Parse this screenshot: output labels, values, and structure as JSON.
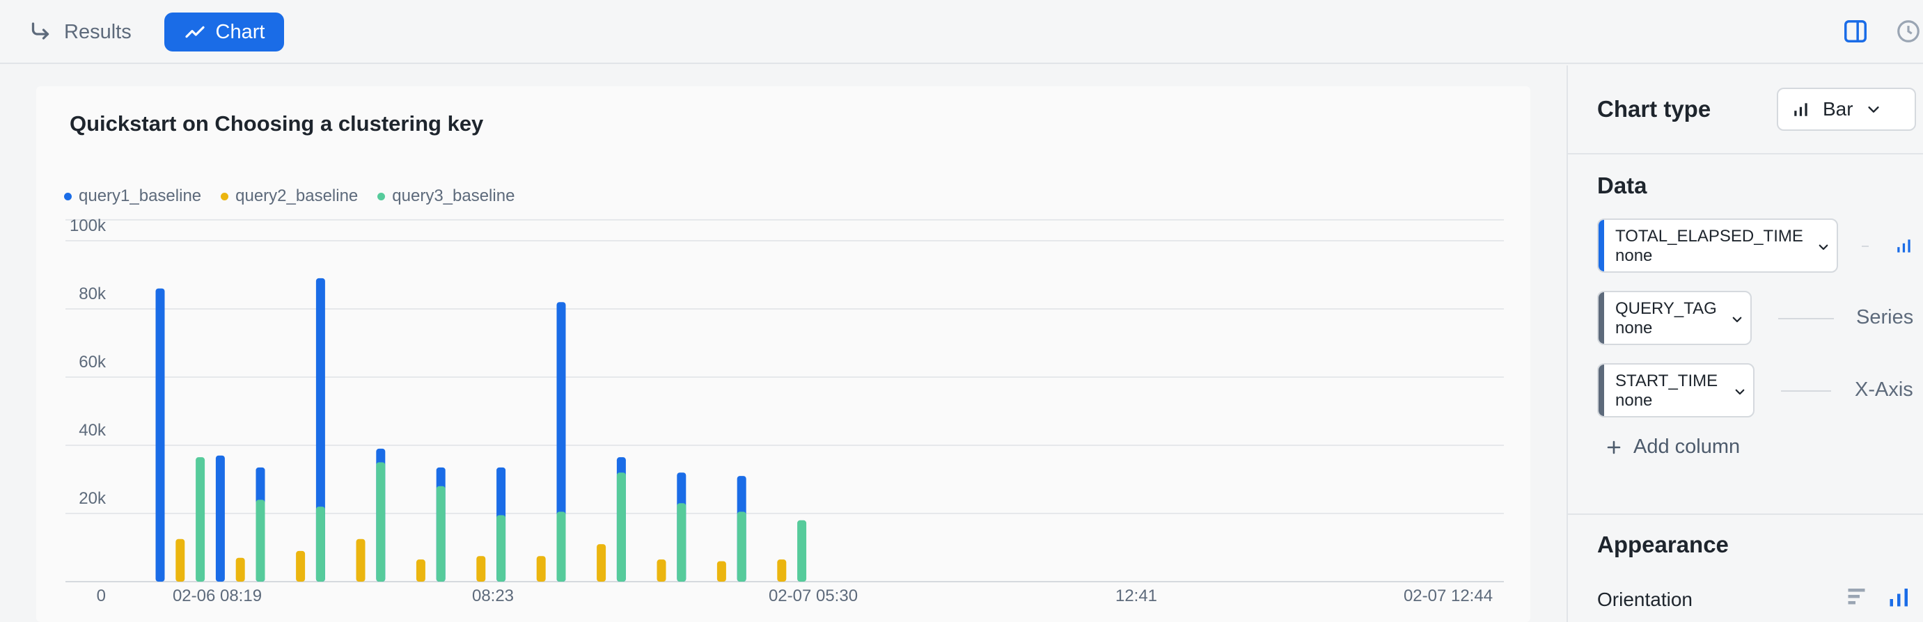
{
  "tabs": {
    "results_label": "Results",
    "chart_label": "Chart"
  },
  "chart_data": {
    "type": "bar",
    "title": "Quickstart on Choosing a clustering key",
    "series": [
      {
        "name": "query1_baseline",
        "color": "#1a6ce7",
        "values": [
          86000,
          0,
          0,
          37000,
          0,
          33500,
          0,
          0,
          89000,
          0,
          0,
          39000,
          0,
          0,
          33500,
          0,
          0,
          33500,
          0,
          0,
          82000,
          0,
          0,
          36500,
          0,
          0,
          32000,
          0,
          0,
          31000,
          0,
          0
        ]
      },
      {
        "name": "query2_baseline",
        "color": "#ebb50f",
        "values": [
          0,
          12500,
          0,
          0,
          7000,
          0,
          0,
          9000,
          0,
          0,
          12500,
          0,
          0,
          6500,
          0,
          0,
          7500,
          0,
          0,
          7500,
          0,
          0,
          11000,
          0,
          0,
          6500,
          0,
          0,
          6000,
          0,
          0,
          6500,
          0
        ]
      },
      {
        "name": "query3_baseline",
        "color": "#56cb9b",
        "values": [
          0,
          0,
          36500,
          0,
          0,
          24000,
          0,
          0,
          22000,
          0,
          0,
          35000,
          0,
          0,
          28000,
          0,
          0,
          19500,
          0,
          0,
          20500,
          0,
          0,
          32000,
          0,
          0,
          23000,
          0,
          0,
          20500,
          0,
          0,
          18000
        ]
      }
    ],
    "y_ticks": [
      "100k",
      "80k",
      "60k",
      "40k",
      "20k",
      "0"
    ],
    "ylim": [
      0,
      100000
    ],
    "x_tick_labels": [
      "02-06 08:19",
      "08:23",
      "02-07 05:30",
      "12:41",
      "02-07 12:44"
    ],
    "grid": true,
    "legend_position": "top-left"
  },
  "sidebar": {
    "chart_type_label": "Chart type",
    "chart_type_value": "Bar",
    "data_label": "Data",
    "columns": [
      {
        "name": "TOTAL_ELAPSED_TIME",
        "agg": "none",
        "role": "",
        "accent": "#1a6ce7"
      },
      {
        "name": "QUERY_TAG",
        "agg": "none",
        "role": "Series",
        "accent": "#5d6a7b"
      },
      {
        "name": "START_TIME",
        "agg": "none",
        "role": "X-Axis",
        "accent": "#5d6a7b"
      }
    ],
    "add_column_label": "Add column",
    "appearance_label": "Appearance",
    "orientation_label": "Orientation"
  }
}
